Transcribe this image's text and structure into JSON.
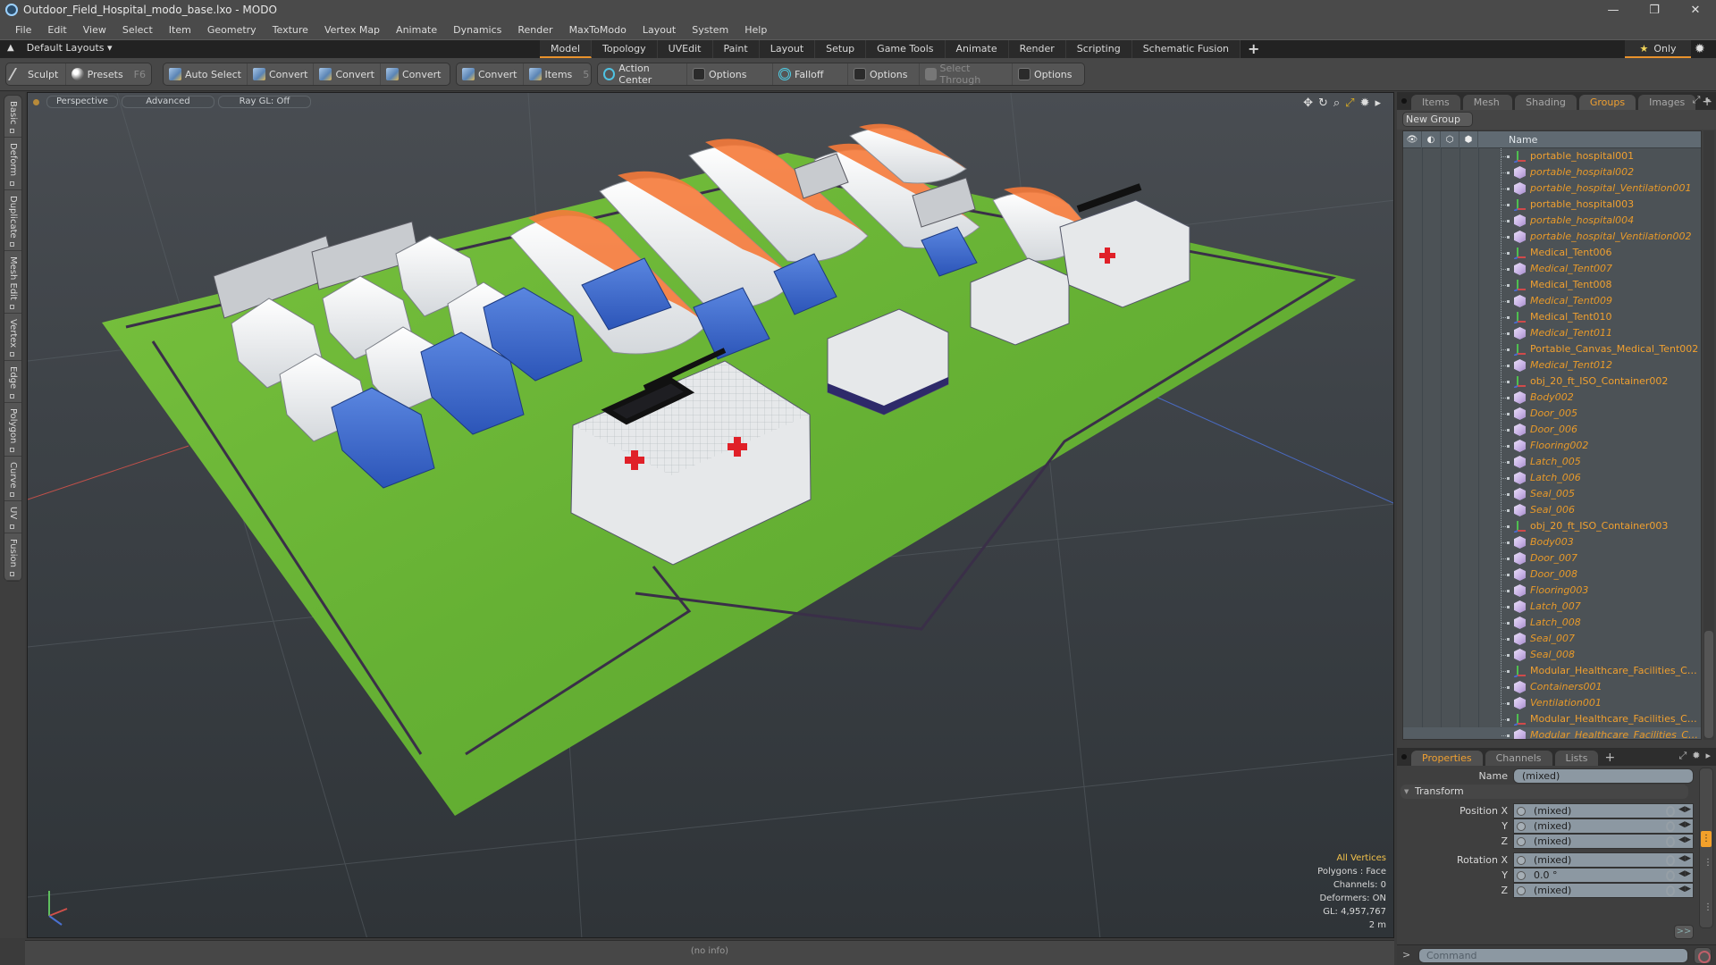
{
  "window": {
    "title": "Outdoor_Field_Hospital_modo_base.lxo - MODO",
    "controls": {
      "minimize": "—",
      "restore": "❐",
      "close": "✕"
    }
  },
  "menu": [
    "File",
    "Edit",
    "View",
    "Select",
    "Item",
    "Geometry",
    "Texture",
    "Vertex Map",
    "Animate",
    "Dynamics",
    "Render",
    "MaxToModo",
    "Layout",
    "System",
    "Help"
  ],
  "layout_bar": {
    "layouts_label": "Default Layouts ▾",
    "tabs": [
      "Model",
      "Topology",
      "UVEdit",
      "Paint",
      "Layout",
      "Setup",
      "Game Tools",
      "Animate",
      "Render",
      "Scripting",
      "Schematic Fusion"
    ],
    "active_tab": "Model",
    "add_label": "+",
    "only_label": "Only"
  },
  "toolbar": {
    "sculpt": "Sculpt",
    "presets": "Presets",
    "presets_hotkey": "F6",
    "auto_select": "Auto Select",
    "convert1": "Convert",
    "convert2": "Convert",
    "convert3": "Convert",
    "convert4": "Convert",
    "items": "Items",
    "items_count": "5",
    "action_center": "Action Center",
    "options1": "Options",
    "falloff": "Falloff",
    "options2": "Options",
    "select_through": "Select Through",
    "options3": "Options"
  },
  "left_tabs": [
    "Basic",
    "Deform",
    "Duplicate",
    "Mesh Edit",
    "Vertex",
    "Edge",
    "Polygon",
    "Curve",
    "UV",
    "Fusion"
  ],
  "viewport": {
    "view_mode": "Perspective",
    "shading": "Advanced",
    "raygl": "Ray GL: Off",
    "info": {
      "selection_mode": "All Vertices",
      "polygons": "Polygons : Face",
      "channels": "Channels: 0",
      "deformers": "Deformers: ON",
      "gl": "GL: 4,957,767",
      "scale": "2 m"
    },
    "colors": {
      "grass": "#6fb83a",
      "tent_white": "#f2f2f2",
      "tent_orange": "#f57a3a",
      "tent_blue": "#3f6fd0",
      "fence": "#3a2f48"
    }
  },
  "status_bar": {
    "info": "(no info)"
  },
  "right_panel": {
    "tabs": [
      "Items",
      "Mesh ...",
      "Shading",
      "Groups",
      "Images"
    ],
    "active_tab": "Groups",
    "new_group_label": "New Group",
    "list_header": {
      "name": "Name"
    },
    "items": [
      {
        "name": "portable_hospital001",
        "type": "locator"
      },
      {
        "name": "portable_hospital002",
        "type": "mesh"
      },
      {
        "name": "portable_hospital_Ventilation001",
        "type": "mesh"
      },
      {
        "name": "portable_hospital003",
        "type": "locator"
      },
      {
        "name": "portable_hospital004",
        "type": "mesh"
      },
      {
        "name": "portable_hospital_Ventilation002",
        "type": "mesh"
      },
      {
        "name": "Medical_Tent006",
        "type": "locator"
      },
      {
        "name": "Medical_Tent007",
        "type": "mesh"
      },
      {
        "name": "Medical_Tent008",
        "type": "locator"
      },
      {
        "name": "Medical_Tent009",
        "type": "mesh"
      },
      {
        "name": "Medical_Tent010",
        "type": "locator"
      },
      {
        "name": "Medical_Tent011",
        "type": "mesh"
      },
      {
        "name": "Portable_Canvas_Medical_Tent002",
        "type": "locator"
      },
      {
        "name": "Medical_Tent012",
        "type": "mesh"
      },
      {
        "name": "obj_20_ft_ISO_Container002",
        "type": "locator"
      },
      {
        "name": "Body002",
        "type": "mesh"
      },
      {
        "name": "Door_005",
        "type": "mesh"
      },
      {
        "name": "Door_006",
        "type": "mesh"
      },
      {
        "name": "Flooring002",
        "type": "mesh"
      },
      {
        "name": "Latch_005",
        "type": "mesh"
      },
      {
        "name": "Latch_006",
        "type": "mesh"
      },
      {
        "name": "Seal_005",
        "type": "mesh"
      },
      {
        "name": "Seal_006",
        "type": "mesh"
      },
      {
        "name": "obj_20_ft_ISO_Container003",
        "type": "locator"
      },
      {
        "name": "Body003",
        "type": "mesh"
      },
      {
        "name": "Door_007",
        "type": "mesh"
      },
      {
        "name": "Door_008",
        "type": "mesh"
      },
      {
        "name": "Flooring003",
        "type": "mesh"
      },
      {
        "name": "Latch_007",
        "type": "mesh"
      },
      {
        "name": "Latch_008",
        "type": "mesh"
      },
      {
        "name": "Seal_007",
        "type": "mesh"
      },
      {
        "name": "Seal_008",
        "type": "mesh"
      },
      {
        "name": "Modular_Healthcare_Facilities_Corpus ...",
        "type": "locator"
      },
      {
        "name": "Containers001",
        "type": "mesh"
      },
      {
        "name": "Ventilation001",
        "type": "mesh"
      },
      {
        "name": "Modular_Healthcare_Facilities_Contai ...",
        "type": "locator"
      },
      {
        "name": "Modular_Healthcare_Facilities_Contai ...",
        "type": "mesh"
      }
    ],
    "props_tabs": [
      "Properties",
      "Channels",
      "Lists"
    ],
    "props_active": "Properties",
    "properties": {
      "name_label": "Name",
      "name_value": "(mixed)",
      "transform_label": "Transform",
      "position": [
        {
          "label": "Position X",
          "value": "(mixed)"
        },
        {
          "label": "Y",
          "value": "(mixed)"
        },
        {
          "label": "Z",
          "value": "(mixed)"
        }
      ],
      "rotation": [
        {
          "label": "Rotation X",
          "value": "(mixed)"
        },
        {
          "label": "Y",
          "value": "0.0 °"
        },
        {
          "label": "Z",
          "value": "(mixed)"
        }
      ],
      "more_label": ">>"
    },
    "command": {
      "prompt": ">",
      "placeholder": "Command"
    }
  }
}
